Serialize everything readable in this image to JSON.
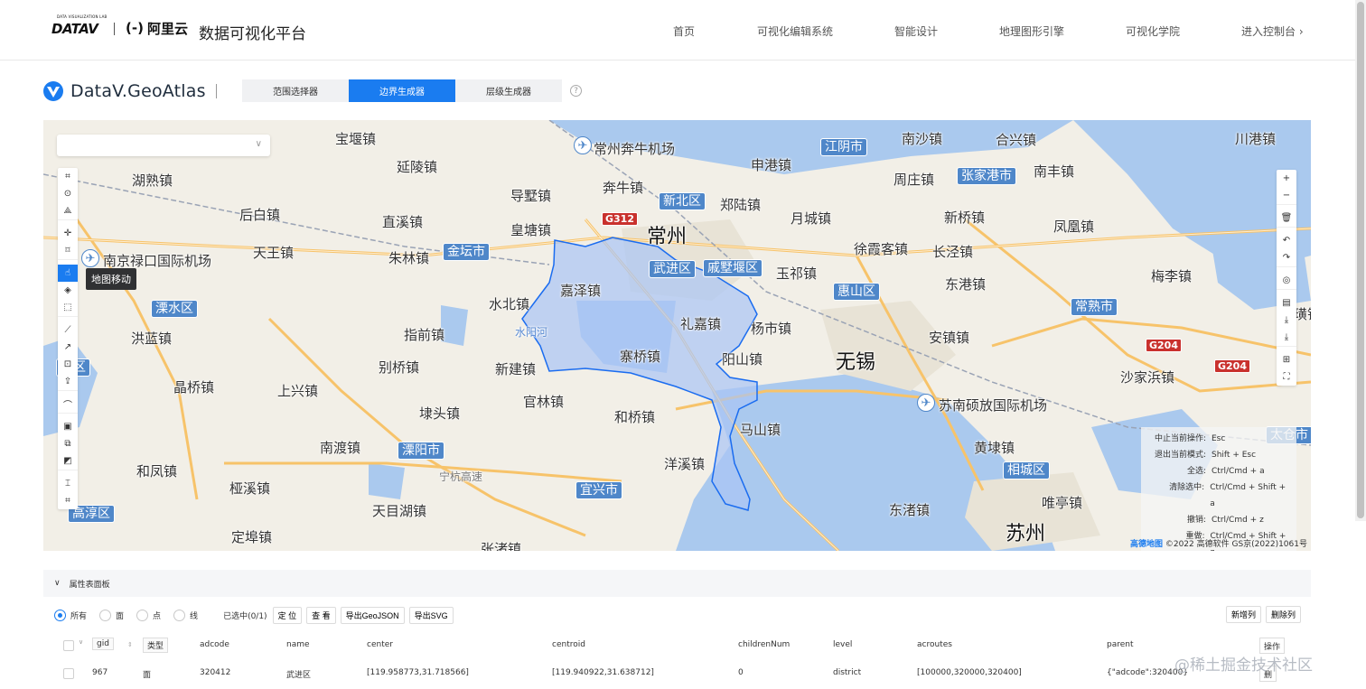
{
  "topnav": {
    "datav_small": "DATA VISUALIZATION LAB",
    "datav_logo": "DATAV",
    "aliyun_bracket": "(-)",
    "aliyun_name": "阿里云",
    "title": "数据可视化平台",
    "items": [
      "首页",
      "可视化编辑系统",
      "智能设计",
      "地理图形引擎",
      "可视化学院",
      "进入控制台 ›"
    ]
  },
  "geoatlas": {
    "title": "DataV.GeoAtlas",
    "tabs": [
      "范围选择器",
      "边界生成器",
      "层级生成器"
    ],
    "active_tab": 1,
    "help": "?"
  },
  "map": {
    "search_value": "",
    "tooltip": "地图移动",
    "labels": {
      "changzhou": "常州",
      "wuxi": "无锡",
      "suzhou": "苏州",
      "baoyan": "宝堰镇",
      "yanling": "延陵镇",
      "hushu": "湖熟镇",
      "houbai": "后白镇",
      "tianwang": "天王镇",
      "daoshu": "导墅镇",
      "benniu": "奔牛镇",
      "huangtang": "皇塘镇",
      "zhixi": "直溪镇",
      "zhulin": "朱林镇",
      "zhengang": "申港镇",
      "zhenglu": "郑陆镇",
      "yuecheng": "月城镇",
      "nanshazhen": "南沙镇",
      "hexing": "合兴镇",
      "chuangang": "川港镇",
      "zhouzhuang": "周庄镇",
      "nanfeng": "南丰镇",
      "xinqiao": "新桥镇",
      "fenghuang": "凤凰镇",
      "xuxiake": "徐霞客镇",
      "changjing": "长泾镇",
      "yuqi": "玉祁镇",
      "dongshan": "东港镇",
      "meili": "梅李镇",
      "jiaze": "嘉泽镇",
      "shuibei": "水北镇",
      "lijia": "礼嘉镇",
      "yangshi": "杨市镇",
      "anzhen": "安镇镇",
      "hongqiao": "洪蓝镇",
      "zhiyin": "指前镇",
      "xinjian": "新建镇",
      "biqiao": "别桥镇",
      "saiqiao": "寨桥镇",
      "yangshan": "阳山镇",
      "jingqiao": "晶桥镇",
      "shangxing": "上兴镇",
      "guanlin": "官林镇",
      "hetao": "和桥镇",
      "dongtou": "埭头镇",
      "nandu": "南渡镇",
      "heping": "和凤镇",
      "yaxi": "桠溪镇",
      "tianmuhu": "天目湖镇",
      "dingbu": "定埠镇",
      "zhangzhu": "张渚镇",
      "yangxi": "洋溪镇",
      "mashan": "马山镇",
      "huangdai": "黄埭镇",
      "weiting": "唯亭镇",
      "dongzhu": "东渚镇",
      "shajiabin": "沙家浜镇",
      "ling": "璜镇",
      "nanjing_airport": "南京禄口国际机场",
      "changzhou_airport": "常州奔牛机场",
      "wuxi_airport": "苏南硕放国际机场",
      "shuiyang": "水阳河",
      "ningxiang": "宁杭高速"
    },
    "badges": {
      "jiangyin": "江阴市",
      "zhangjiagang": "张家港市",
      "changshu": "常熟市",
      "xinbei": "新北区",
      "wujin": "武进区",
      "qishuyan": "戚墅堰区",
      "huishan": "惠山区",
      "jintan": "金坛市",
      "lishui": "溧水区",
      "liyang": "溧阳市",
      "yixing": "宜兴市",
      "gaochun": "高淳区",
      "xiangcheng": "相城区",
      "taicang": "太仓市",
      "gaoqiao": "高区"
    },
    "shields": {
      "g312": "G312",
      "g204a": "G204",
      "g204b": "G204"
    },
    "shortcuts": [
      {
        "k": "中止当前操作:",
        "v": "Esc"
      },
      {
        "k": "退出当前模式:",
        "v": "Shift + Esc"
      },
      {
        "k": "全选:",
        "v": "Ctrl/Cmd + a"
      },
      {
        "k": "清除选中:",
        "v": "Ctrl/Cmd + Shift + a"
      },
      {
        "k": "撤销:",
        "v": "Ctrl/Cmd + z"
      },
      {
        "k": "重做:",
        "v": "Ctrl/Cmd + Shift + z"
      }
    ],
    "copyright_brand": "高德地图",
    "copyright": "©2022 高德软件 GS京(2022)1061号",
    "colors": {
      "boundary": "#1a6cf0",
      "boundary_fill": "#a9c4f5",
      "water": "#aac9ee",
      "road": "#f7c36a"
    }
  },
  "panel": {
    "title": "属性表面板",
    "radios": [
      "所有",
      "面",
      "点",
      "线"
    ],
    "checked_radio": 0,
    "selected_count": "已选中(0/1)",
    "buttons": [
      "定 位",
      "查 看",
      "导出GeoJSON",
      "导出SVG"
    ],
    "right_buttons": [
      "新增列",
      "删除列"
    ],
    "columns": [
      "gid",
      "类型",
      "adcode",
      "name",
      "center",
      "centroid",
      "childrenNum",
      "level",
      "acroutes",
      "parent",
      "操作"
    ],
    "rows": [
      {
        "gid": "967",
        "type": "面",
        "adcode": "320412",
        "name": "武进区",
        "center": "[119.958773,31.718566]",
        "centroid": "[119.940922,31.638712]",
        "childrenNum": "0",
        "level": "district",
        "acroutes": "[100000,320000,320400]",
        "parent": "{\"adcode\":320400}",
        "op": "删"
      }
    ]
  },
  "watermark": "@稀土掘金技术社区"
}
